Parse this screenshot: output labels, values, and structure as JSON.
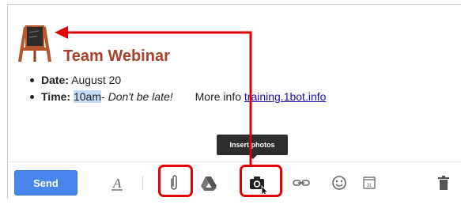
{
  "email": {
    "title": "Team Webinar",
    "bullets": {
      "date_label": "Date:",
      "date_value": " August 20",
      "time_label": "Time:",
      "time_highlight": "10am",
      "time_rest": "- ",
      "time_note": "Don't be late!",
      "more_info_text": "More info ",
      "link_text": "training.1bot.info"
    }
  },
  "toolbar": {
    "send_label": "Send",
    "tooltip": "Insert photos",
    "calendar_number": "31",
    "icons": [
      "text-format-icon",
      "attach-icon",
      "drive-icon",
      "camera-icon",
      "link-icon",
      "emoji-icon",
      "calendar-icon",
      "trash-icon"
    ]
  },
  "colors": {
    "send_blue": "#4885ed",
    "title_color": "#a5422b",
    "highlight_red": "#e00000",
    "link_color": "#1a0dab"
  }
}
